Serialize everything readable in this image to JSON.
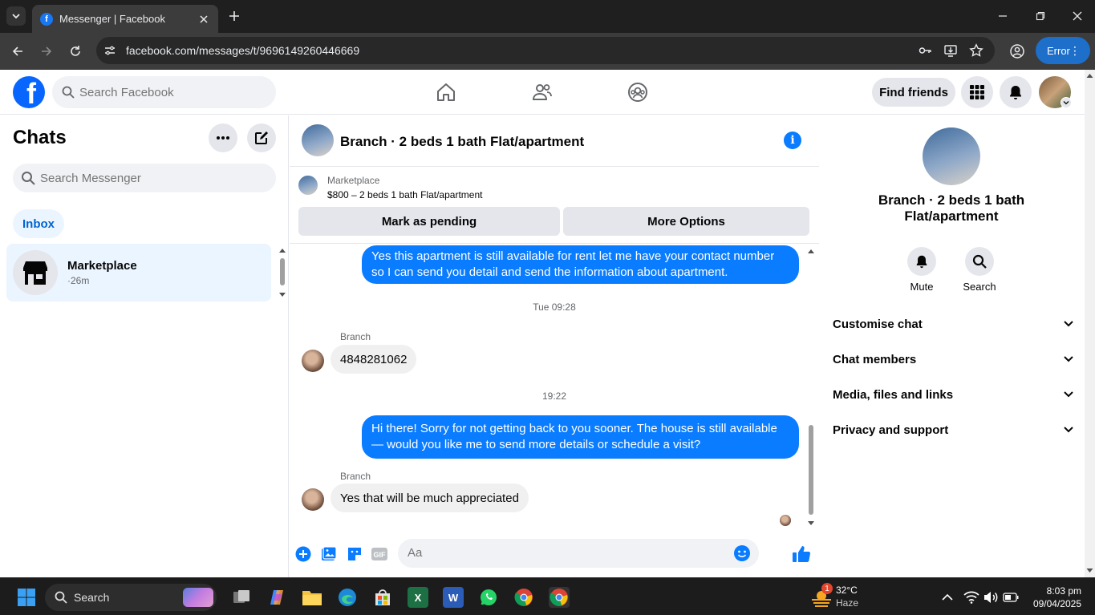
{
  "browser": {
    "tab_title": "Messenger | Facebook",
    "url": "facebook.com/messages/t/9696149260446669",
    "error_label": "Error"
  },
  "header": {
    "search_placeholder": "Search Facebook",
    "find_friends": "Find friends"
  },
  "sidebar": {
    "title": "Chats",
    "search_placeholder": "Search Messenger",
    "inbox_label": "Inbox",
    "chats": [
      {
        "name": "Marketplace",
        "time": "·26m"
      }
    ]
  },
  "conversation": {
    "title": "Branch · 2 beds 1 bath Flat/apartment",
    "marketplace_label": "Marketplace",
    "listing": "$800 – 2 beds 1 bath Flat/apartment",
    "mark_pending": "Mark as pending",
    "more_options": "More Options",
    "messages": [
      {
        "dir": "out",
        "text": "Yes this apartment is still available for rent let me have your contact number so I can send you detail and send the information about apartment."
      },
      {
        "type": "time",
        "text": "Tue 09:28"
      },
      {
        "dir": "in",
        "sender": "Branch",
        "text": "4848281062"
      },
      {
        "type": "time",
        "text": "19:22"
      },
      {
        "dir": "out",
        "text": "Hi there! Sorry for not getting back to you sooner. The house is still available — would you like me to send more details or schedule a visit?"
      },
      {
        "dir": "in",
        "sender": "Branch",
        "text": "Yes that will be much appreciated"
      }
    ],
    "composer_placeholder": "Aa"
  },
  "details": {
    "title": "Branch · 2 beds 1 bath Flat/apartment",
    "mute": "Mute",
    "search": "Search",
    "sections": [
      "Customise chat",
      "Chat members",
      "Media, files and links",
      "Privacy and support"
    ]
  },
  "taskbar": {
    "search": "Search",
    "weather_temp": "32°C",
    "weather_cond": "Haze",
    "weather_badge": "1",
    "time": "8:03 pm",
    "date": "09/04/2025"
  },
  "colors": {
    "facebook_blue": "#0866ff",
    "messenger_blue": "#0a7cff",
    "selected_bg": "#ebf5ff"
  }
}
